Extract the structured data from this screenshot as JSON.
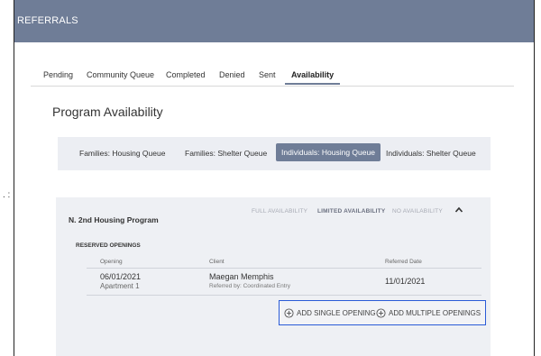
{
  "header": {
    "title": "REFERRALS"
  },
  "tabs": [
    "Pending",
    "Community Queue",
    "Completed",
    "Denied",
    "Sent",
    "Availability"
  ],
  "page_title": "Program Availability",
  "queues": [
    "Families: Housing Queue",
    "Families: Shelter Queue",
    "Individuals: Housing Queue",
    "Individuals: Shelter Queue"
  ],
  "stray_mark": ". :",
  "program": {
    "name": "N. 2nd Housing Program",
    "availability": [
      "FULL AVAILABILITY",
      "LIMITED AVAILABILITY",
      "NO AVAILABILITY"
    ],
    "reserved_title": "RESERVED OPENINGS",
    "columns": [
      "Opening",
      "Client",
      "Referred Date"
    ],
    "row": {
      "opening_date": "06/01/2021",
      "opening_unit": "Apartment 1",
      "client_name": "Maegan Memphis",
      "referred_by": "Referred by: Coordinated Entry",
      "referred_date": "11/01/2021"
    },
    "actions": {
      "add_single": "ADD SINGLE OPENING",
      "add_multiple": "ADD MULTIPLE OPENINGS"
    }
  },
  "colors": {
    "header": "#6f7d97",
    "highlight_border": "#2a5bd7",
    "card_bg": "#eef0f4"
  }
}
